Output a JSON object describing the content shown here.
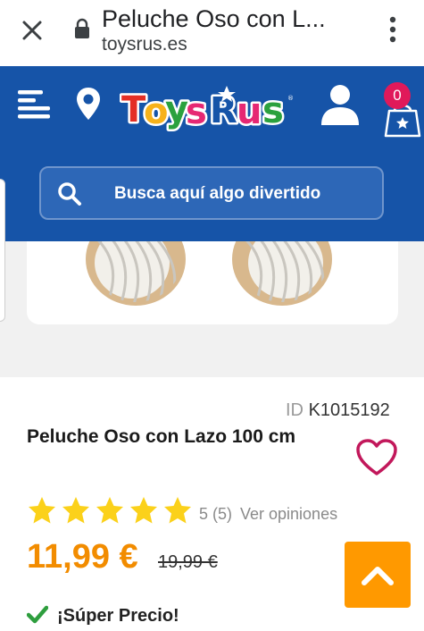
{
  "browser": {
    "title": "Peluche Oso con L...",
    "url": "toysrus.es"
  },
  "header": {
    "logo_text": "TOYS R US",
    "cart_count": "0",
    "search_placeholder": "Busca aquí algo divertido"
  },
  "product": {
    "id_label": "ID",
    "id_value": "K1015192",
    "title": "Peluche Oso con Lazo 100 cm",
    "rating": 5,
    "rating_text": "5 (5)",
    "reviews_link": "Ver opiniones",
    "price": "11,99 €",
    "old_price": "19,99 €",
    "promo": "¡Súper Precio!"
  },
  "colors": {
    "header_blue": "#1654a8",
    "price_orange": "#f28c00",
    "star_yellow": "#fbd11a",
    "heart_magenta": "#c2185b",
    "badge_pink": "#e0195a",
    "scroll_button": "#ff9900"
  }
}
